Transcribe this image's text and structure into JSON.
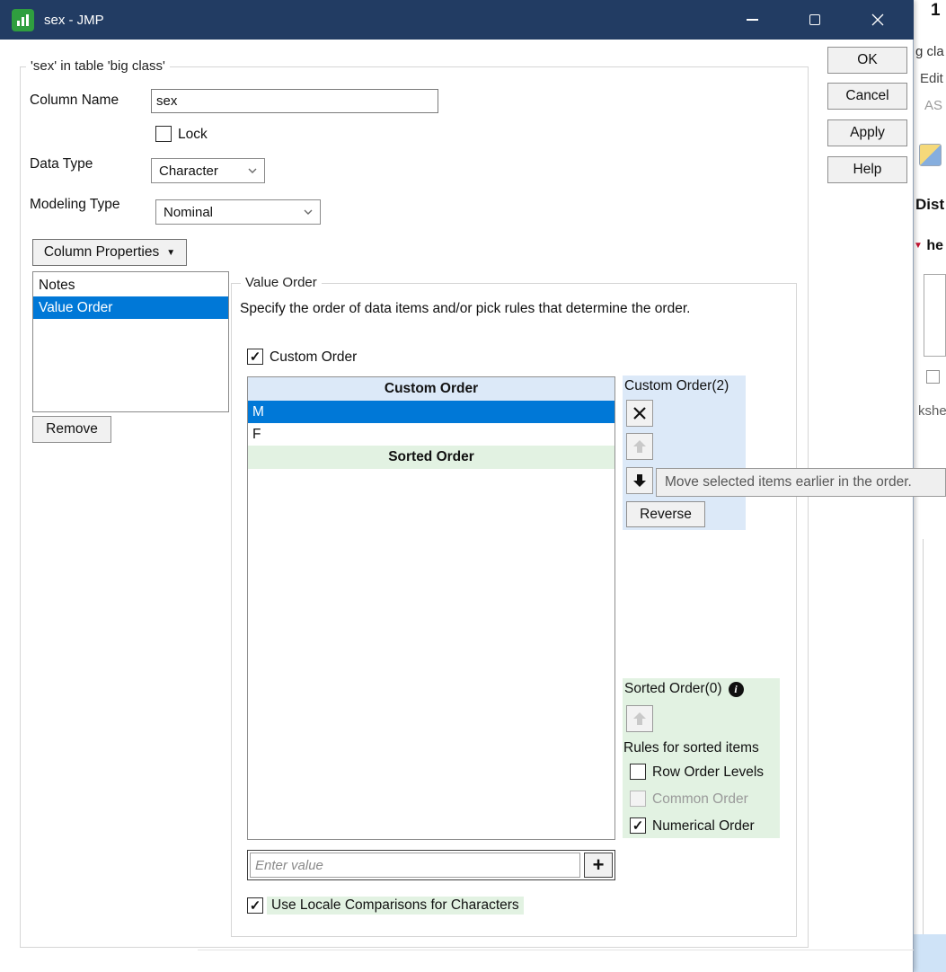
{
  "titlebar": {
    "title": "sex - JMP"
  },
  "icons": {
    "dropdown_triangle": "▼",
    "plus": "+",
    "red_triangle": "▼"
  },
  "dialog": {
    "group_legend": "'sex' in table 'big class'",
    "column_name": {
      "label": "Column Name",
      "value": "sex"
    },
    "lock": {
      "label": "Lock",
      "checked": false
    },
    "data_type": {
      "label": "Data Type",
      "value": "Character"
    },
    "modeling_type": {
      "label": "Modeling Type",
      "value": "Nominal"
    },
    "column_properties_button": "Column Properties",
    "properties_list": {
      "items": [
        "Notes",
        "Value Order"
      ],
      "selected": "Value Order"
    },
    "remove_button": "Remove",
    "action_buttons": {
      "ok": "OK",
      "cancel": "Cancel",
      "apply": "Apply",
      "help": "Help"
    }
  },
  "value_order": {
    "legend": "Value Order",
    "description": "Specify the order of data items and/or pick rules that determine the order.",
    "custom_order_checkbox": {
      "label": "Custom Order",
      "checked": true
    },
    "order_list": {
      "custom_header": "Custom Order",
      "items": [
        "M",
        "F"
      ],
      "selected": "M",
      "sorted_header": "Sorted Order"
    },
    "custom_panel": {
      "title": "Custom Order(2)",
      "reverse_button": "Reverse"
    },
    "tooltip": "Move selected items earlier in the order.",
    "sorted_panel": {
      "title": "Sorted Order(0)",
      "rules_heading": "Rules for sorted items",
      "row_order_levels": {
        "label": "Row Order Levels",
        "checked": false
      },
      "common_order": {
        "label": "Common Order",
        "checked": false,
        "disabled": true
      },
      "numerical_order": {
        "label": "Numerical Order",
        "checked": true
      }
    },
    "value_input": {
      "placeholder": "Enter value"
    },
    "locale_checkbox": {
      "label": "Use Locale Comparisons for Characters",
      "checked": true
    }
  },
  "background_window": {
    "row_number": "1",
    "frag_big_class": "g cla",
    "frag_edit": "Edit",
    "frag_as": "AS",
    "frag_dist": "Dist",
    "frag_he": "he",
    "frag_kshe": "kshe"
  },
  "colors": {
    "titlebar": "#223c63",
    "selection": "#0078d7",
    "custom_order_bg": "#dce9f8",
    "sorted_order_bg": "#e2f2e2"
  }
}
